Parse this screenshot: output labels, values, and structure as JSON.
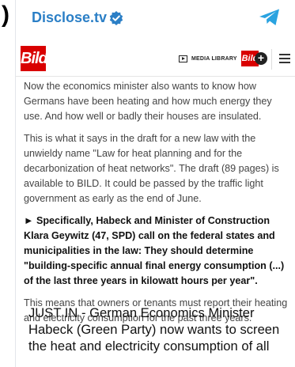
{
  "channel": {
    "name": "Disclose.tv"
  },
  "bild": {
    "logo_text": "Bild",
    "media_library": "MEDIA LIBRARY",
    "plus_logo_text": "Bild"
  },
  "article": {
    "paragraphs": [
      "Now the economics minister also wants to know how Germans have been heating and how much energy they use. And how well or badly their houses are insulated.",
      "This is what it says in the draft for a new law with the unwieldy name \"Law for heat planning and for the decarbonization of heat networks\". The draft (89 pages) is available to BILD. It could be passed by the traffic light government as early as the end of June.",
      "► Specifically, Habeck and Minister of Construction Klara Geywitz (47, SPD) call on the federal states and municipalities in the law: They should determine \"building-specific annual final energy consumption (...) of the last three years in kilowatt hours per year\".",
      "This means that owners or tenants must report their heating and electricity consumption for the past three years."
    ]
  },
  "caption": "JUST IN - German Economics Minister Habeck (Green Party) now wants to screen the heat and electricity consumption of all",
  "colors": {
    "channel_blue": "#2b7fc6",
    "telegram_blue": "#2aa3e0",
    "bild_red": "#d90000"
  },
  "icons": {
    "verified": "verified-badge-icon",
    "telegram": "telegram-icon",
    "media": "play-icon",
    "menu": "hamburger-menu-icon"
  }
}
